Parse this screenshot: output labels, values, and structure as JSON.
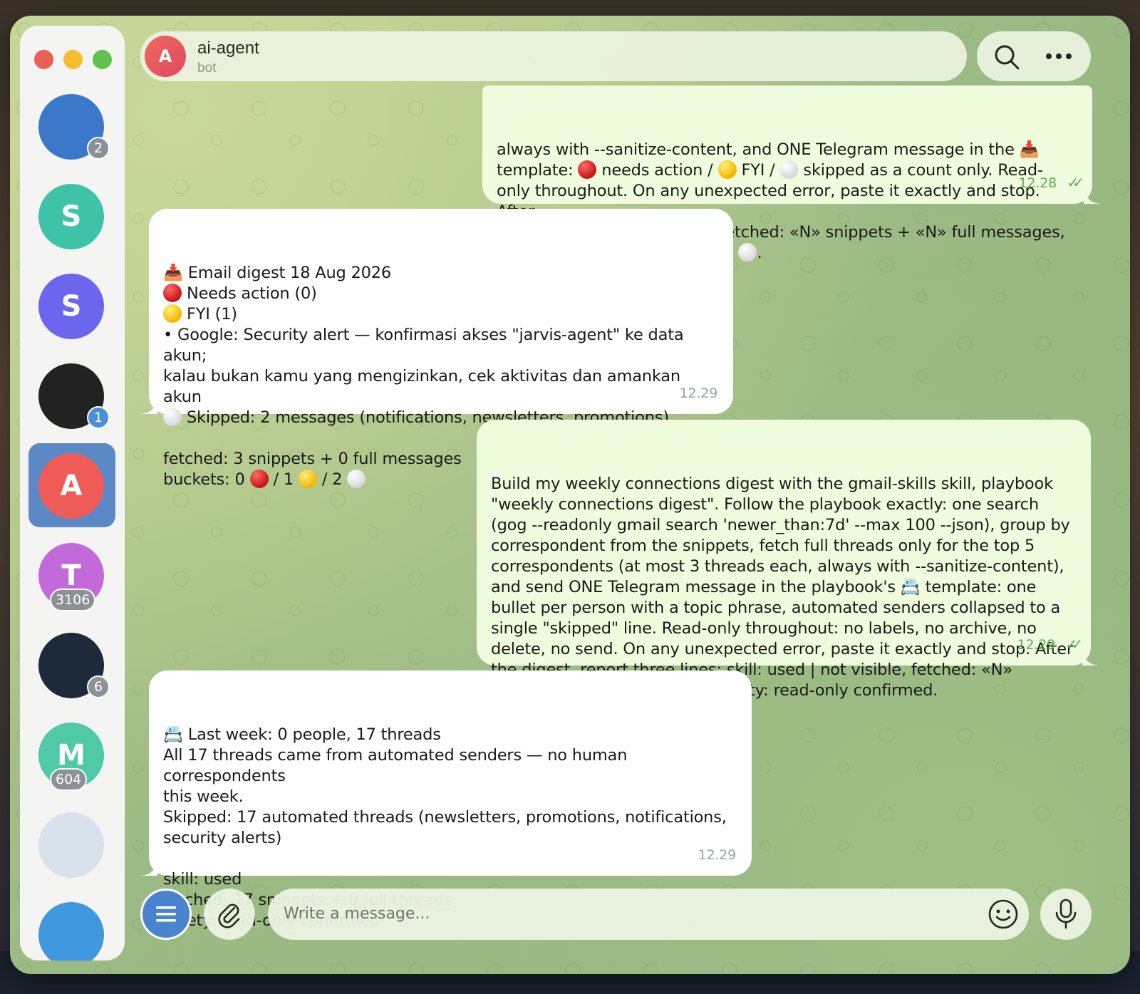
{
  "sidebar": {
    "chats": [
      {
        "initial": "",
        "badge": "2",
        "color": "#3b78c9"
      },
      {
        "initial": "S",
        "badge": "",
        "color": "#3fc3a8"
      },
      {
        "initial": "S",
        "badge": "",
        "color": "#6c66ef"
      },
      {
        "initial": "",
        "badge": "1",
        "color": "#222222"
      },
      {
        "initial": "A",
        "badge": "",
        "color": "#ef5b57"
      },
      {
        "initial": "T",
        "badge": "3106",
        "color": "#c26ad9"
      },
      {
        "initial": "",
        "badge": "6",
        "color": "#1c2a3a"
      },
      {
        "initial": "M",
        "badge": "604",
        "color": "#4fc9a6"
      },
      {
        "initial": "",
        "badge": "",
        "color": "#d9e2ea"
      },
      {
        "initial": "",
        "badge": "",
        "color": "#3f97de"
      }
    ]
  },
  "header": {
    "avatar_initial": "A",
    "title": "ai-agent",
    "subtitle": "bot"
  },
  "messages": [
    {
      "dir": "out",
      "lines": [
        "always with --sanitize-content, and ONE Telegram message in the 📥",
        "template: {R} needs action / {Y} FYI / {W} skipped as a count only. Read-",
        "only throughout. On any unexpected error, paste it exactly and stop. After",
        "the digest, report two lines: fetched: «N» snippets + «N» full messages,",
        "buckets: «n» {R} / «n» {Y} / «n» {W}."
      ],
      "time": "12.28"
    },
    {
      "dir": "in",
      "lines": [
        "📥 Email digest 18 Aug 2026",
        "{R} Needs action (0)",
        "{Y} FYI (1)",
        "• Google: Security alert — konfirmasi akses \"jarvis-agent\" ke data akun;",
        "kalau bukan kamu yang mengizinkan, cek aktivitas dan amankan akun",
        "{W} Skipped: 2 messages (notifications, newsletters, promotions)",
        "",
        "fetched: 3 snippets + 0 full messages",
        "buckets: 0 {R} / 1 {Y} / 2 {W}"
      ],
      "time": "12.29"
    },
    {
      "dir": "out",
      "lines": [
        "Build my weekly connections digest with the gmail-skills skill, playbook",
        "\"weekly connections digest\". Follow the playbook exactly: one search",
        "(gog --readonly gmail search 'newer_than:7d' --max 100 --json), group by",
        "correspondent from the snippets, fetch full threads only for the top 5",
        "correspondents (at most 3 threads each, always with --sanitize-content),",
        "and send ONE Telegram message in the playbook's 📇 template: one",
        "bullet per person with a topic phrase, automated senders collapsed to a",
        "single \"skipped\" line. Read-only throughout: no labels, no archive, no",
        "delete, no send. On any unexpected error, paste it exactly and stop. After",
        "the digest, report three lines: skill: used | not visible, fetched: «N»",
        "snippets + «N» full threads, safety: read-only confirmed."
      ],
      "time": "12.29"
    },
    {
      "dir": "in",
      "lines": [
        "📇 Last week: 0 people, 17 threads",
        "All 17 threads came from automated senders — no human correspondents",
        "this week.",
        "Skipped: 17 automated threads (newsletters, promotions, notifications,",
        "security alerts)",
        "",
        "skill: used",
        "fetched: 17 snippets + 0 full threads",
        "safety: read-only confirmed"
      ],
      "time": "12.29"
    }
  ],
  "composer": {
    "placeholder": "Write a message..."
  }
}
